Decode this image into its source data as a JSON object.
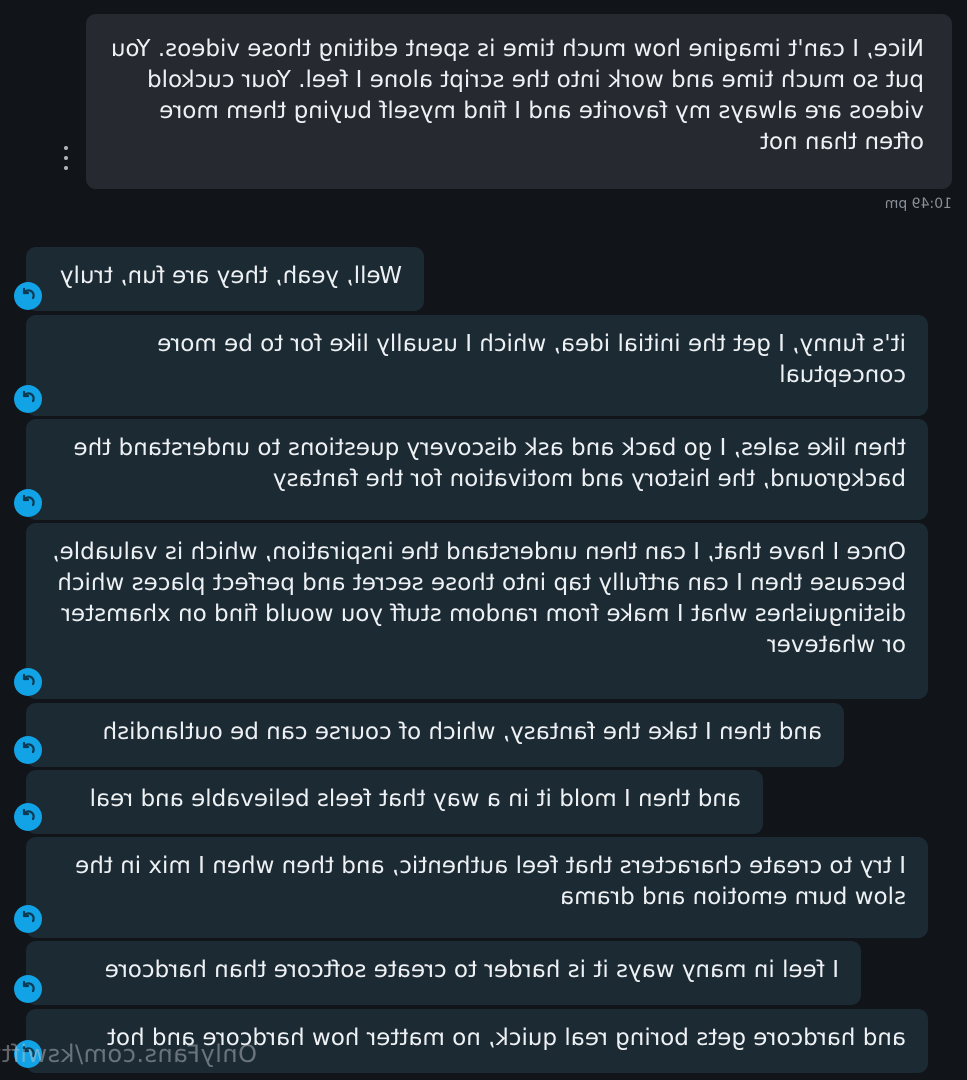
{
  "chat": {
    "sent": {
      "text": "Nice, I can't imagine how much time is spent editing those videos. You put so much time and work into the script alone I feel. Your cuckold videos are always my favorite and I find myself buying them more often than not",
      "time": "10:49 pm"
    },
    "received": [
      {
        "text": "Well, yeah, they are fun, truly"
      },
      {
        "text": "it's funny, I get the initial idea, which I usually like for to be more conceptual"
      },
      {
        "text": "then like sales, I go back and ask discovery questions to understand the background, the history and motivation for the fantasy"
      },
      {
        "text": "Once I have that, I can then understand the inspiration, which is valuable, because then I can artfully tap into those secret and perfect places which distinguishes what I make from random stuff you would find on xhamster or whatever"
      },
      {
        "text": "and then I take the fantasy, which of course can be outlandish"
      },
      {
        "text": "and then I mold it in a way that feels believable and real"
      },
      {
        "text": "I try to create characters that feel authentic, and then when I mix in the slow burn emotion and drama"
      },
      {
        "text": "I feel in many ways it is harder to create softcore than hardcore"
      },
      {
        "text": "and hardcore gets boring real quick, no matter how hardcore and hot"
      }
    ]
  },
  "watermark": "OnlyFans.com/kswifty",
  "colors": {
    "background": "#111418",
    "sent_bubble": "#262a30",
    "received_bubble": "#1c2a33",
    "avatar": "#12a2e6"
  },
  "icons": {
    "menu": "more-vertical-icon",
    "avatar": "redo-arrow-icon"
  },
  "note_mirrored": "rendered horizontally mirrored as in screenshot"
}
